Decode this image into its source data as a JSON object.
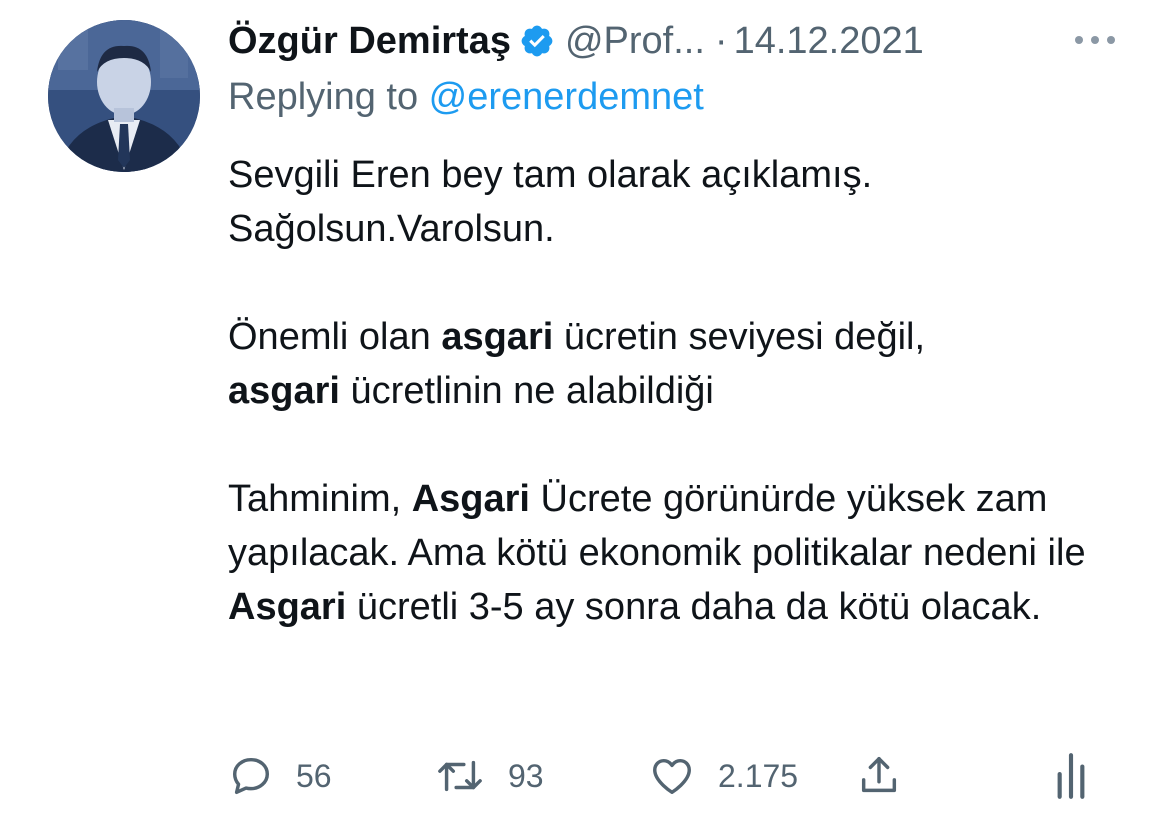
{
  "author": {
    "name": "Özgür Demirtaş",
    "handle": "@Prof...",
    "separator": "·",
    "date": "14.12.2021",
    "verified_icon": "verified-badge-icon",
    "avatar": "profile-photo"
  },
  "reply": {
    "prefix": "Replying to ",
    "mention": "@erenerdemnet"
  },
  "tweet": {
    "p1_line1": "Sevgili Eren bey tam olarak açıklamış.",
    "p1_line2": "Sağolsun.Varolsun.",
    "p2_a": "Önemli olan ",
    "p2_b": "asgari",
    "p2_c": " ücretin seviyesi değil,",
    "p2_d": "asgari",
    "p2_e": " ücretlinin ne alabildiği",
    "p3_a": "Tahminim, ",
    "p3_b": "Asgari",
    "p3_c": " Ücrete görünürde yüksek zam yapılacak. Ama kötü ekonomik politikalar nedeni ile ",
    "p3_d": "Asgari",
    "p3_e": " ücretli 3-5 ay sonra daha da kötü olacak."
  },
  "actions": {
    "replies": "56",
    "retweets": "93",
    "likes": "2.175"
  },
  "colors": {
    "accent": "#1d9bf0",
    "secondary_text": "#536471",
    "primary_text": "#0f1419"
  }
}
